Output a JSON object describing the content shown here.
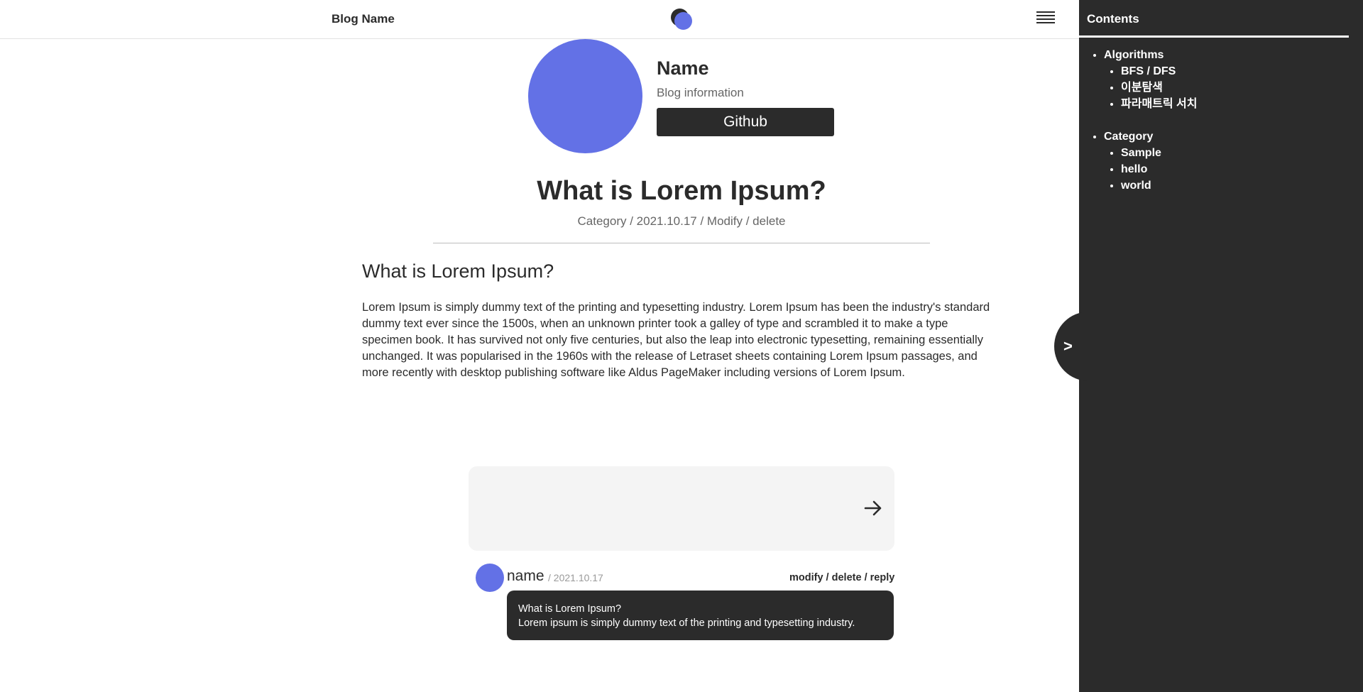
{
  "header": {
    "blog_name": "Blog Name",
    "logo_icon": "logo-icon",
    "menu_icon": "hamburger-menu-icon"
  },
  "profile": {
    "name": "Name",
    "info": "Blog information",
    "github_label": "Github"
  },
  "post": {
    "title": "What is Lorem Ipsum?",
    "meta": {
      "category": "Category",
      "date": "2021.10.17",
      "modify": "Modify",
      "delete": "delete",
      "separator": " / "
    },
    "heading": "What is Lorem Ipsum?",
    "body": "Lorem Ipsum is simply dummy text of the printing and typesetting industry. Lorem Ipsum has been the industry's standard dummy text ever since the 1500s, when an unknown printer took a galley of type and scrambled it to make a type specimen book. It has survived not only five centuries, but also the leap into electronic typesetting, remaining essentially unchanged. It was popularised in the 1960s with the release of Letraset sheets containing Lorem Ipsum passages, and more recently with desktop publishing software like Aldus PageMaker including versions of Lorem Ipsum."
  },
  "toggle": {
    "label": ">"
  },
  "sidebar": {
    "title": "Contents",
    "groups": [
      {
        "label": "Algorithms",
        "items": [
          "BFS / DFS",
          "이분탐색",
          "파라매트릭 서치"
        ]
      },
      {
        "label": "Category",
        "items": [
          "Sample",
          "hello",
          "world"
        ]
      }
    ]
  },
  "comment_form": {
    "placeholder": "",
    "send_icon": "arrow-right-icon"
  },
  "comments": [
    {
      "name": "name",
      "date": "/ 2021.10.17",
      "modify": "modify",
      "delete": "delete",
      "reply": "reply",
      "line1": "What is Lorem Ipsum?",
      "line2": "Lorem ipsum is simply dummy text of the printing and typesetting industry."
    }
  ],
  "colors": {
    "accent": "#6371e6",
    "dark": "#2b2b2b",
    "input_bg": "#f4f4f4"
  }
}
